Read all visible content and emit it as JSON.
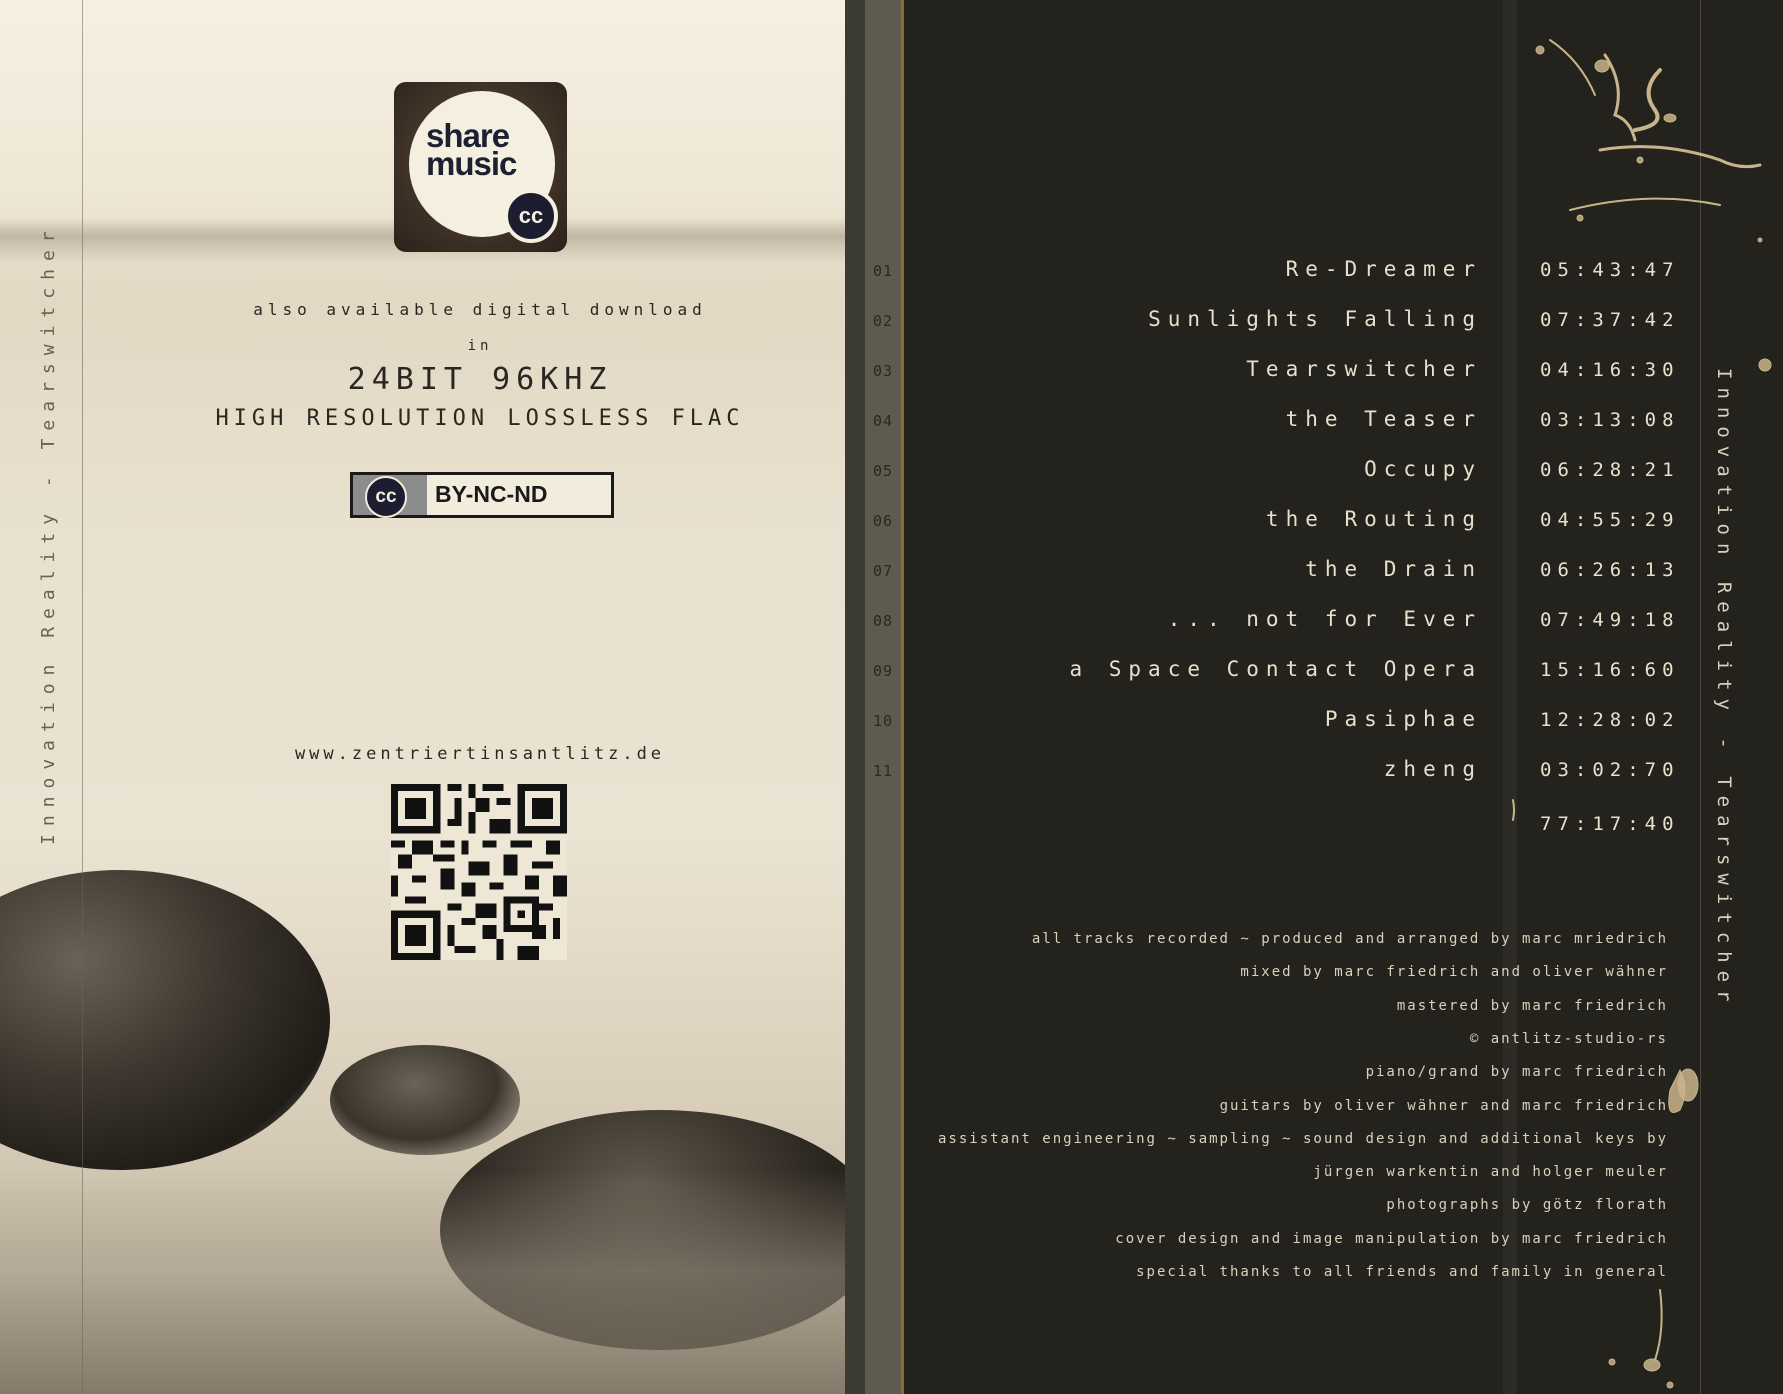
{
  "spine": {
    "left_text": "Innovation  Reality  -  Tearswitcher",
    "right_text": "Innovation  Reality  -  Tearswitcher"
  },
  "logo": {
    "line1": "share",
    "line2": "music",
    "badge": "cc"
  },
  "download": {
    "line1": "also available digital download",
    "line2": "in",
    "line3": "24BIT 96KHZ",
    "line4": "HIGH RESOLUTION LOSSLESS FLAC"
  },
  "license": {
    "badge": "cc",
    "label": "BY-NC-ND"
  },
  "website": "www.zentriertinsantlitz.de",
  "tracks": [
    {
      "num": "01",
      "title": "Re-Dreamer",
      "time": "05:43:47"
    },
    {
      "num": "02",
      "title": "Sunlights Falling",
      "time": "07:37:42"
    },
    {
      "num": "03",
      "title": "Tearswitcher",
      "time": "04:16:30"
    },
    {
      "num": "04",
      "title": "the Teaser",
      "time": "03:13:08"
    },
    {
      "num": "05",
      "title": "Occupy",
      "time": "06:28:21"
    },
    {
      "num": "06",
      "title": "the Routing",
      "time": "04:55:29"
    },
    {
      "num": "07",
      "title": "the Drain",
      "time": "06:26:13"
    },
    {
      "num": "08",
      "title": "... not for Ever",
      "time": "07:49:18"
    },
    {
      "num": "09",
      "title": "a Space Contact Opera",
      "time": "15:16:60"
    },
    {
      "num": "10",
      "title": "Pasiphae",
      "time": "12:28:02"
    },
    {
      "num": "11",
      "title": "zheng",
      "time": "03:02:70"
    }
  ],
  "total_time": "77:17:40",
  "credits": [
    "all tracks recorded ~ produced and arranged by marc mriedrich",
    "mixed by marc friedrich and oliver wähner",
    "mastered by marc friedrich",
    "© antlitz-studio-rs",
    "piano/grand by marc friedrich",
    "guitars by oliver wähner and marc friedrich",
    "assistant engineering ~ sampling ~ sound design and additional keys by",
    "jürgen warkentin and holger meuler",
    "photographs by götz florath",
    "cover design and image manipulation by marc friedrich",
    "special thanks to all friends and family in general"
  ],
  "colors": {
    "panel_dark": "#23221c",
    "text_light": "#e8e0cb",
    "paper": "#efe7d5",
    "accent_line": "#8c6a2a",
    "splatter": "#c8b48a"
  }
}
